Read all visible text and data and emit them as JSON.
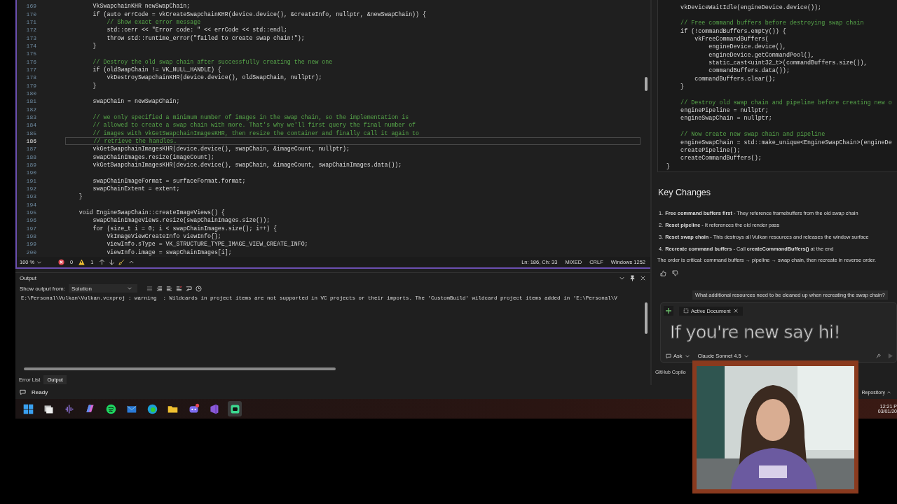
{
  "editor": {
    "lines": [
      {
        "number": "169",
        "kind": "code",
        "selected": false,
        "text": "        VkSwapchainKHR newSwapChain;"
      },
      {
        "number": "170",
        "kind": "code",
        "selected": false,
        "text": "        if (auto errCode = vkCreateSwapchainKHR(device.device(), &createInfo, nullptr, &newSwapChain)) {"
      },
      {
        "number": "171",
        "kind": "comment",
        "selected": false,
        "text": "            // Show exact error message"
      },
      {
        "number": "172",
        "kind": "code",
        "selected": false,
        "text": "            std::cerr << \"Error code: \" << errCode << std::endl;"
      },
      {
        "number": "173",
        "kind": "code",
        "selected": false,
        "text": "            throw std::runtime_error(\"failed to create swap chain!\");"
      },
      {
        "number": "174",
        "kind": "code",
        "selected": false,
        "text": "        }"
      },
      {
        "number": "175",
        "selected": false
      },
      {
        "number": "176",
        "kind": "comment",
        "selected": false,
        "text": "        // Destroy the old swap chain after successfully creating the new one"
      },
      {
        "number": "177",
        "kind": "code",
        "selected": false,
        "text": "        if (oldSwapChain != VK_NULL_HANDLE) {"
      },
      {
        "number": "178",
        "kind": "code",
        "selected": false,
        "text": "            vkDestroySwapchainKHR(device.device(), oldSwapChain, nullptr);"
      },
      {
        "number": "179",
        "kind": "code",
        "selected": false,
        "text": "        }"
      },
      {
        "number": "180",
        "selected": false
      },
      {
        "number": "181",
        "kind": "code",
        "selected": false,
        "text": "        swapChain = newSwapChain;"
      },
      {
        "number": "182",
        "selected": false
      },
      {
        "number": "183",
        "kind": "comment",
        "selected": false,
        "text": "        // we only specified a minimum number of images in the swap chain, so the implementation is"
      },
      {
        "number": "184",
        "kind": "comment",
        "selected": false,
        "text": "        // allowed to create a swap chain with more. That's why we'll first query the final number of"
      },
      {
        "number": "185",
        "kind": "comment",
        "selected": false,
        "text": "        // images with vkGetSwapchainImagesKHR, then resize the container and finally call it again to"
      },
      {
        "number": "186",
        "kind": "comment",
        "selected": true,
        "text": "        // retrieve the handles."
      },
      {
        "number": "187",
        "kind": "code",
        "selected": false,
        "text": "        vkGetSwapchainImagesKHR(device.device(), swapChain, &imageCount, nullptr);"
      },
      {
        "number": "188",
        "kind": "code",
        "selected": false,
        "text": "        swapChainImages.resize(imageCount);"
      },
      {
        "number": "189",
        "kind": "code",
        "selected": false,
        "text": "        vkGetSwapchainImagesKHR(device.device(), swapChain, &imageCount, swapChainImages.data());"
      },
      {
        "number": "190",
        "selected": false
      },
      {
        "number": "191",
        "kind": "code",
        "selected": false,
        "text": "        swapChainImageFormat = surfaceFormat.format;"
      },
      {
        "number": "192",
        "kind": "code",
        "selected": false,
        "text": "        swapChainExtent = extent;"
      },
      {
        "number": "193",
        "kind": "code",
        "selected": false,
        "text": "    }"
      },
      {
        "number": "194",
        "selected": false
      },
      {
        "number": "195",
        "kind": "code",
        "selected": false,
        "text": "    void EngineSwapChain::createImageViews() {"
      },
      {
        "number": "196",
        "kind": "code",
        "selected": false,
        "text": "        swapChainImageViews.resize(swapChainImages.size());"
      },
      {
        "number": "197",
        "kind": "code",
        "selected": false,
        "text": "        for (size_t i = 0; i < swapChainImages.size(); i++) {"
      },
      {
        "number": "198",
        "kind": "code",
        "selected": false,
        "text": "            VkImageViewCreateInfo viewInfo{};"
      },
      {
        "number": "199",
        "kind": "code",
        "selected": false,
        "text": "            viewInfo.sType = VK_STRUCTURE_TYPE_IMAGE_VIEW_CREATE_INFO;"
      },
      {
        "number": "200",
        "kind": "code",
        "selected": false,
        "text": "            viewInfo.image = swapChainImages[i];"
      }
    ],
    "status": {
      "zoom": "100 %",
      "errors": "0",
      "warnings": "1",
      "position": "Ln: 186, Ch: 33",
      "mode": "MIXED",
      "line_endings": "CRLF",
      "encoding": "Windows 1252"
    }
  },
  "output": {
    "title": "Output",
    "source_label": "Show output from:",
    "source": "Solution",
    "text": "E:\\Personal\\Vulkan\\Vulkan.vcxproj : warning  : Wildcards in project items are not supported in VC projects or their imports. The 'CustomBuild' wildcard project items added in 'E:\\Personal\\V"
  },
  "bottom_tabs": [
    {
      "label": "Error List",
      "selected": false
    },
    {
      "label": "Output",
      "selected": true
    }
  ],
  "copilot": {
    "code_lines": [
      {
        "kind": "code",
        "text": "    vkDeviceWaitIdle(engineDevice.device());"
      },
      {
        "kind": "blank"
      },
      {
        "kind": "comment",
        "text": "    // Free command buffers before destroying swap chain"
      },
      {
        "kind": "code",
        "text": "    if (!commandBuffers.empty()) {"
      },
      {
        "kind": "code",
        "text": "        vkFreeCommandBuffers("
      },
      {
        "kind": "code",
        "text": "            engineDevice.device(),"
      },
      {
        "kind": "code",
        "text": "            engineDevice.getCommandPool(),"
      },
      {
        "kind": "code",
        "text": "            static_cast<uint32_t>(commandBuffers.size()),"
      },
      {
        "kind": "code",
        "text": "            commandBuffers.data());"
      },
      {
        "kind": "code",
        "text": "        commandBuffers.clear();"
      },
      {
        "kind": "code",
        "text": "    }"
      },
      {
        "kind": "blank"
      },
      {
        "kind": "comment",
        "text": "    // Destroy old swap chain and pipeline before creating new o"
      },
      {
        "kind": "code",
        "text": "    enginePipeline = nullptr;"
      },
      {
        "kind": "code",
        "text": "    engineSwapChain = nullptr;"
      },
      {
        "kind": "blank"
      },
      {
        "kind": "comment",
        "text": "    // Now create new swap chain and pipeline"
      },
      {
        "kind": "code",
        "text": "    engineSwapChain = std::make_unique<EngineSwapChain>(engineDe"
      },
      {
        "kind": "code",
        "text": "    createPipeline();"
      },
      {
        "kind": "code",
        "text": "    createCommandBuffers();"
      },
      {
        "kind": "code",
        "text": "}"
      }
    ],
    "heading": "Key Changes",
    "changes": [
      {
        "number": "1.",
        "text": "**Free command buffers first** - They reference framebuffers from the old swap chain"
      },
      {
        "number": "2.",
        "text": "**Reset pipeline** - It references the old render pass"
      },
      {
        "number": "3.",
        "text": "**Reset swap chain** - This destroys all Vulkan resources and releases the window surface"
      },
      {
        "number": "4.",
        "text": "**Recreate command buffers** - Call **createCommandBuffers()** at the end"
      }
    ],
    "summary": "The order is critical: command buffers → pipeline → swap chain, then recreate in reverse order.",
    "question": "What additional resources need to be cleaned up when recreating the swap chain?",
    "context_chip": "Active Document",
    "mode": "Ask",
    "model": "Claude Sonnet 4.5",
    "tab": "GitHub Copilo",
    "repository": "Repository"
  },
  "status_bar": "Ready",
  "taskbar": {
    "apps": [
      {
        "kind": "start",
        "selected": false
      },
      {
        "kind": "taskview",
        "selected": false
      },
      {
        "kind": "audio",
        "selected": false
      },
      {
        "kind": "copilot",
        "selected": false
      },
      {
        "kind": "spotify",
        "selected": false
      },
      {
        "kind": "mail",
        "selected": false
      },
      {
        "kind": "edge",
        "selected": false
      },
      {
        "kind": "folder",
        "selected": false
      },
      {
        "kind": "discord",
        "selected": false
      },
      {
        "kind": "studio",
        "selected": false
      },
      {
        "kind": "chat",
        "selected": true
      }
    ],
    "time": "12:21 P",
    "date": "03/01/20"
  },
  "overlay": {
    "text": "If you're new say hi!"
  }
}
